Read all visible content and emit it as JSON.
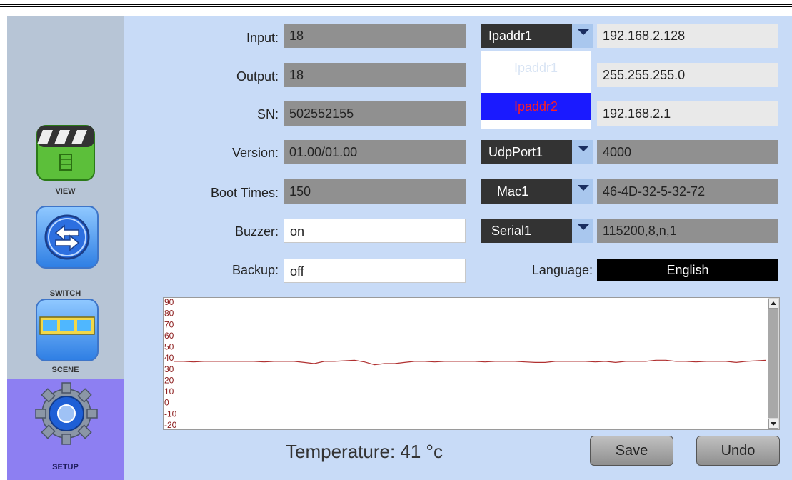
{
  "nav": [
    {
      "label": "VIEW",
      "icon": "clapperboard-icon"
    },
    {
      "label": "SWITCH",
      "icon": "switch-arrows-icon"
    },
    {
      "label": "SCENE",
      "icon": "film-strip-icon"
    },
    {
      "label": "SETUP",
      "icon": "gear-icon",
      "active": true
    }
  ],
  "info": {
    "input": {
      "label": "Input:",
      "value": "18"
    },
    "output": {
      "label": "Output:",
      "value": "18"
    },
    "sn": {
      "label": "SN:",
      "value": "502552155"
    },
    "version": {
      "label": "Version:",
      "value": "01.00/01.00"
    },
    "boot": {
      "label": "Boot Times:",
      "value": "150"
    },
    "buzzer": {
      "label": "Buzzer:",
      "value": "on"
    },
    "backup": {
      "label": "Backup:",
      "value": "off"
    }
  },
  "network": {
    "ip_select": "Ipaddr1",
    "ip_options": [
      "Ipaddr1",
      "Ipaddr2"
    ],
    "ip_value": "192.168.2.128",
    "mask_value": "255.255.255.0",
    "gateway_value": "192.168.2.1",
    "udp_select": "UdpPort1",
    "udp_value": "4000",
    "mac_select": "Mac1",
    "mac_value": "46-4D-32-5-32-72",
    "serial_select": "Serial1",
    "serial_value": "115200,8,n,1",
    "language_label": "Language:",
    "language_value": "English"
  },
  "chart_data": {
    "type": "line",
    "ylim": [
      -20,
      90
    ],
    "y_ticks": [
      "90",
      "80",
      "70",
      "60",
      "50",
      "40",
      "30",
      "20",
      "10",
      "0",
      "-10",
      "-20"
    ],
    "series": [
      {
        "color": "#b03030",
        "values": [
          37,
          37,
          36.5,
          37,
          37,
          37,
          37,
          37,
          37,
          36.5,
          37,
          37,
          37,
          36,
          35,
          37,
          37,
          37.5,
          38,
          36.5,
          34,
          35,
          35,
          36,
          37,
          37,
          36.5,
          37,
          37,
          37,
          37,
          36.5,
          37,
          37,
          37,
          36.5,
          36,
          36,
          37,
          37,
          37,
          37,
          36.5,
          37,
          36,
          37,
          37,
          37,
          38,
          38,
          37,
          37,
          36.5,
          37,
          37,
          37,
          36,
          37,
          37.5,
          38
        ]
      }
    ]
  },
  "footer": {
    "temperature": "Temperature: 41 °c",
    "save": "Save",
    "undo": "Undo"
  },
  "colors": {
    "accent": "#8d7ff2",
    "background": "#c8dbf7",
    "line": "#b03030"
  }
}
